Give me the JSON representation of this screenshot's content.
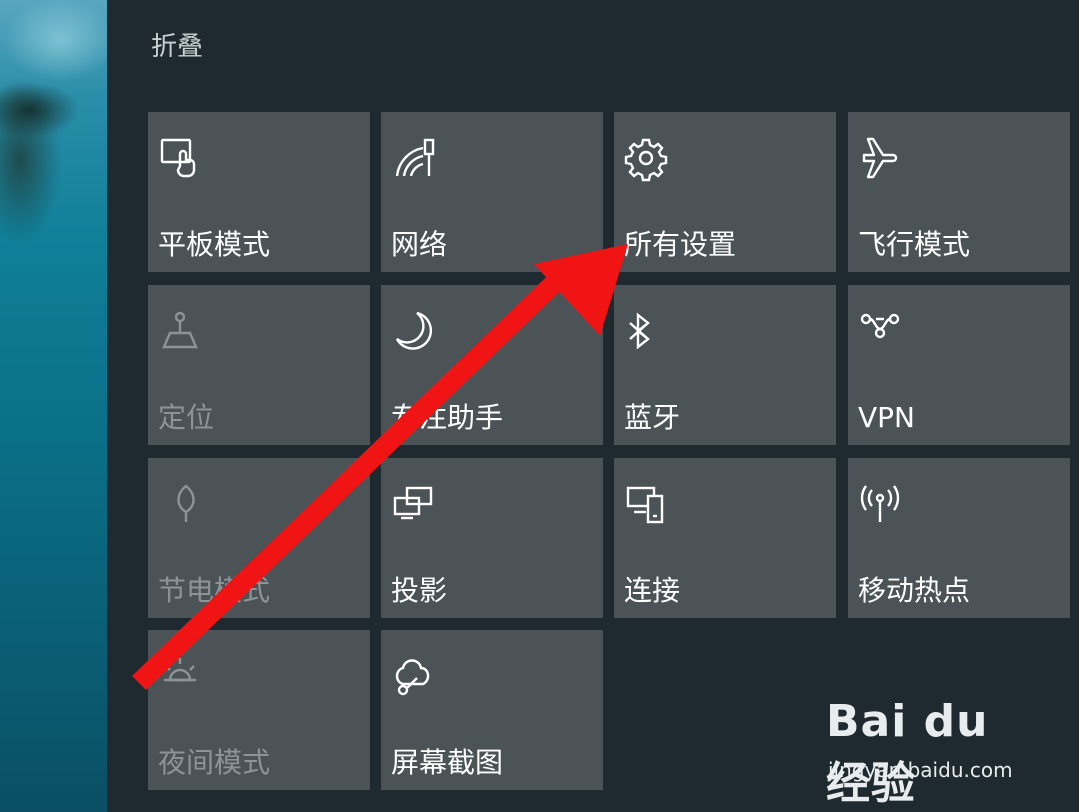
{
  "panel": {
    "collapse_label": "折叠"
  },
  "tiles": [
    {
      "id": "tablet",
      "label": "平板模式",
      "icon": "tablet-mode-icon",
      "enabled": true
    },
    {
      "id": "network",
      "label": "网络",
      "icon": "network-icon",
      "enabled": true
    },
    {
      "id": "all-settings",
      "label": "所有设置",
      "icon": "gear-icon",
      "enabled": true
    },
    {
      "id": "airplane",
      "label": "飞行模式",
      "icon": "airplane-icon",
      "enabled": true
    },
    {
      "id": "location",
      "label": "定位",
      "icon": "location-icon",
      "enabled": false
    },
    {
      "id": "focus-assist",
      "label": "专注助手",
      "icon": "moon-icon",
      "enabled": true
    },
    {
      "id": "bluetooth",
      "label": "蓝牙",
      "icon": "bluetooth-icon",
      "enabled": true
    },
    {
      "id": "vpn",
      "label": "VPN",
      "icon": "vpn-icon",
      "enabled": true
    },
    {
      "id": "battery-saver",
      "label": "节电模式",
      "icon": "battery-saver-icon",
      "enabled": false
    },
    {
      "id": "project",
      "label": "投影",
      "icon": "project-icon",
      "enabled": true
    },
    {
      "id": "connect",
      "label": "连接",
      "icon": "connect-icon",
      "enabled": true
    },
    {
      "id": "hotspot",
      "label": "移动热点",
      "icon": "hotspot-icon",
      "enabled": true
    },
    {
      "id": "night-light",
      "label": "夜间模式",
      "icon": "brightness-icon",
      "enabled": false
    },
    {
      "id": "snip",
      "label": "屏幕截图",
      "icon": "snip-icon",
      "enabled": true
    }
  ],
  "annotation": {
    "arrow_color": "#f01414"
  },
  "watermark": {
    "logo_text": "Bai du 经验",
    "url": "jingyan.baidu.com"
  },
  "colors": {
    "panel_bg": "#1e2a2f",
    "tile_bg": "#4b5356",
    "tile_label": "#ffffff",
    "tile_label_disabled": "#8d9497"
  }
}
